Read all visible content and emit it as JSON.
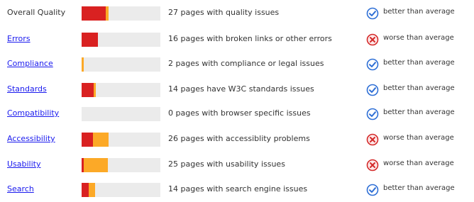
{
  "colors": {
    "link": "#1a1aee",
    "bar_track": "#ebebeb",
    "bar_red": "#d92121",
    "bar_orange": "#fca927",
    "better_icon": "#2e6fd6",
    "worse_icon": "#d42a2a"
  },
  "rows": [
    {
      "category": "Overall Quality",
      "is_link": false,
      "bar_red_fraction": 0.31,
      "bar_orange_fraction": 0.035,
      "description": "27 pages with quality issues",
      "status": "better than average",
      "status_icon": "check-circle-icon"
    },
    {
      "category": "Errors",
      "is_link": true,
      "bar_red_fraction": 0.21,
      "bar_orange_fraction": 0.0,
      "description": "16 pages with broken links or other errors",
      "status": "worse than average",
      "status_icon": "x-circle-icon"
    },
    {
      "category": "Compliance",
      "is_link": true,
      "bar_red_fraction": 0.0,
      "bar_orange_fraction": 0.025,
      "description": "2 pages with compliance or legal issues",
      "status": "better than average",
      "status_icon": "check-circle-icon"
    },
    {
      "category": "Standards",
      "is_link": true,
      "bar_red_fraction": 0.15,
      "bar_orange_fraction": 0.03,
      "description": "14 pages have W3C standards issues",
      "status": "better than average",
      "status_icon": "check-circle-icon"
    },
    {
      "category": "Compatibility",
      "is_link": true,
      "bar_red_fraction": 0.0,
      "bar_orange_fraction": 0.0,
      "description": "0 pages with browser specific issues",
      "status": "better than average",
      "status_icon": "check-circle-icon"
    },
    {
      "category": "Accessibility",
      "is_link": true,
      "bar_red_fraction": 0.14,
      "bar_orange_fraction": 0.2,
      "description": "26 pages with accessiblity problems",
      "status": "worse than average",
      "status_icon": "x-circle-icon"
    },
    {
      "category": "Usability",
      "is_link": true,
      "bar_red_fraction": 0.03,
      "bar_orange_fraction": 0.31,
      "description": "25 pages with usability issues",
      "status": "worse than average",
      "status_icon": "x-circle-icon"
    },
    {
      "category": "Search",
      "is_link": true,
      "bar_red_fraction": 0.09,
      "bar_orange_fraction": 0.08,
      "description": "14 pages with search engine issues",
      "status": "better than average",
      "status_icon": "check-circle-icon"
    }
  ]
}
